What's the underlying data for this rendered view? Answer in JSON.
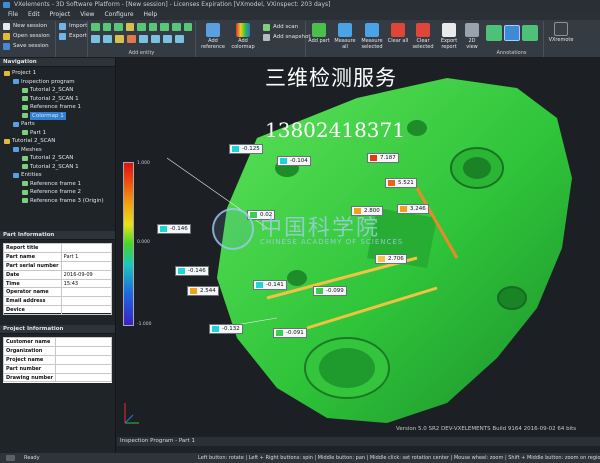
{
  "window": {
    "title": "VXelements - 3D Software Platform - [New session] - Licenses Expiration [VXmodel, VXinspect: 203 days]"
  },
  "menu": [
    "File",
    "Edit",
    "Project",
    "View",
    "Configure",
    "Help"
  ],
  "ribbon": {
    "session": {
      "new": "New session",
      "open": "Open session",
      "save": "Save session"
    },
    "file": {
      "import": "Import",
      "export": "Export"
    },
    "entity_caption": "Add entity",
    "inspection": {
      "add_scan": "Add scan",
      "add_snapshot": "Add snapshot",
      "add_reference": "Add reference",
      "add_colormap": "Add colormap"
    },
    "annotations": {
      "add_part": "Add part",
      "measure_all": "Measure all",
      "measure_selected": "Measure selected",
      "clear_all": "Clear all",
      "clear_selected": "Clear selected",
      "export_report": "Export report",
      "view_2d": "2D view",
      "caption": "Annotations",
      "vxremote": "VXremote"
    }
  },
  "navigation": {
    "title": "Navigation",
    "items": [
      {
        "label": "Project 1",
        "indent": 0
      },
      {
        "label": "Inspection program",
        "indent": 1
      },
      {
        "label": "Tutorial 2_SCAN",
        "indent": 2
      },
      {
        "label": "Tutorial 2_SCAN 1",
        "indent": 2
      },
      {
        "label": "Reference frame 1",
        "indent": 2
      },
      {
        "label": "Colormap 1",
        "indent": 2,
        "selected": true
      },
      {
        "label": "Parts",
        "indent": 1
      },
      {
        "label": "Part 1",
        "indent": 2
      },
      {
        "label": "Tutorial 2_SCAN",
        "indent": 0
      },
      {
        "label": "Meshes",
        "indent": 1
      },
      {
        "label": "Tutorial 2_SCAN",
        "indent": 2
      },
      {
        "label": "Tutorial 2_SCAN 1",
        "indent": 2
      },
      {
        "label": "Entities",
        "indent": 1
      },
      {
        "label": "Reference frame 1",
        "indent": 2
      },
      {
        "label": "Reference frame 2",
        "indent": 2
      },
      {
        "label": "Reference frame 3 (Origin)",
        "indent": 2
      }
    ]
  },
  "part_information": {
    "title": "Part Information",
    "rows": [
      {
        "key": "Report title",
        "value": ""
      },
      {
        "key": "Part name",
        "value": "Part 1"
      },
      {
        "key": "Part serial number",
        "value": ""
      },
      {
        "key": "Date",
        "value": "2016-09-09"
      },
      {
        "key": "Time",
        "value": "15:43"
      },
      {
        "key": "Operator name",
        "value": ""
      },
      {
        "key": "Email address",
        "value": ""
      },
      {
        "key": "Device",
        "value": ""
      }
    ]
  },
  "project_information": {
    "title": "Project Information",
    "rows": [
      {
        "key": "Customer name",
        "value": ""
      },
      {
        "key": "Organization",
        "value": ""
      },
      {
        "key": "Project name",
        "value": ""
      },
      {
        "key": "Part number",
        "value": ""
      },
      {
        "key": "Drawing number",
        "value": ""
      }
    ]
  },
  "colormap_scale": {
    "top": "1.000",
    "middle": "0.000",
    "bottom": "-1.000"
  },
  "callouts": [
    {
      "value": "-0.125",
      "color": "#1fd3d9"
    },
    {
      "value": "-0.104",
      "color": "#1fd3d9"
    },
    {
      "value": "7.187",
      "color": "#e23a12"
    },
    {
      "value": "5.521",
      "color": "#e8621a"
    },
    {
      "value": "3.246",
      "color": "#f0a21c"
    },
    {
      "value": "2.800",
      "color": "#f0a21c"
    },
    {
      "value": "2.706",
      "color": "#f3c54a"
    },
    {
      "value": "-0.146",
      "color": "#1fd3d9"
    },
    {
      "value": "-0.146",
      "color": "#1fd3d9"
    },
    {
      "value": "2.544",
      "color": "#f0a21c"
    },
    {
      "value": "-0.141",
      "color": "#1fd3d9"
    },
    {
      "value": "-0.099",
      "color": "#39cf4a"
    },
    {
      "value": "-0.132",
      "color": "#1fd3d9"
    },
    {
      "value": "-0.091",
      "color": "#39cf4a"
    },
    {
      "value": "0.02",
      "color": "#39cf4a"
    }
  ],
  "overlay": {
    "title": "三维检测服务",
    "phone": "13802418371",
    "watermark": "中国科学院",
    "watermark_sub": "CHINESE ACADEMY OF SCIENCES"
  },
  "viewport": {
    "version": "Version 5.0 SR2 DEV-VXELEMENTS Build 9164 2016-09-02 64 bits",
    "tab": "Inspection Program - Part 1"
  },
  "status": {
    "ready": "Ready",
    "hints": "Left button: rotate | Left + Right buttons: spin | Middle button: pan | Middle click: set rotation center | Mouse wheel: zoom | Shift + Middle button: zoom on region"
  },
  "colors": {
    "accent": "#2f7fd3",
    "part_green": "#3bd13a",
    "panel": "#1f2429"
  }
}
